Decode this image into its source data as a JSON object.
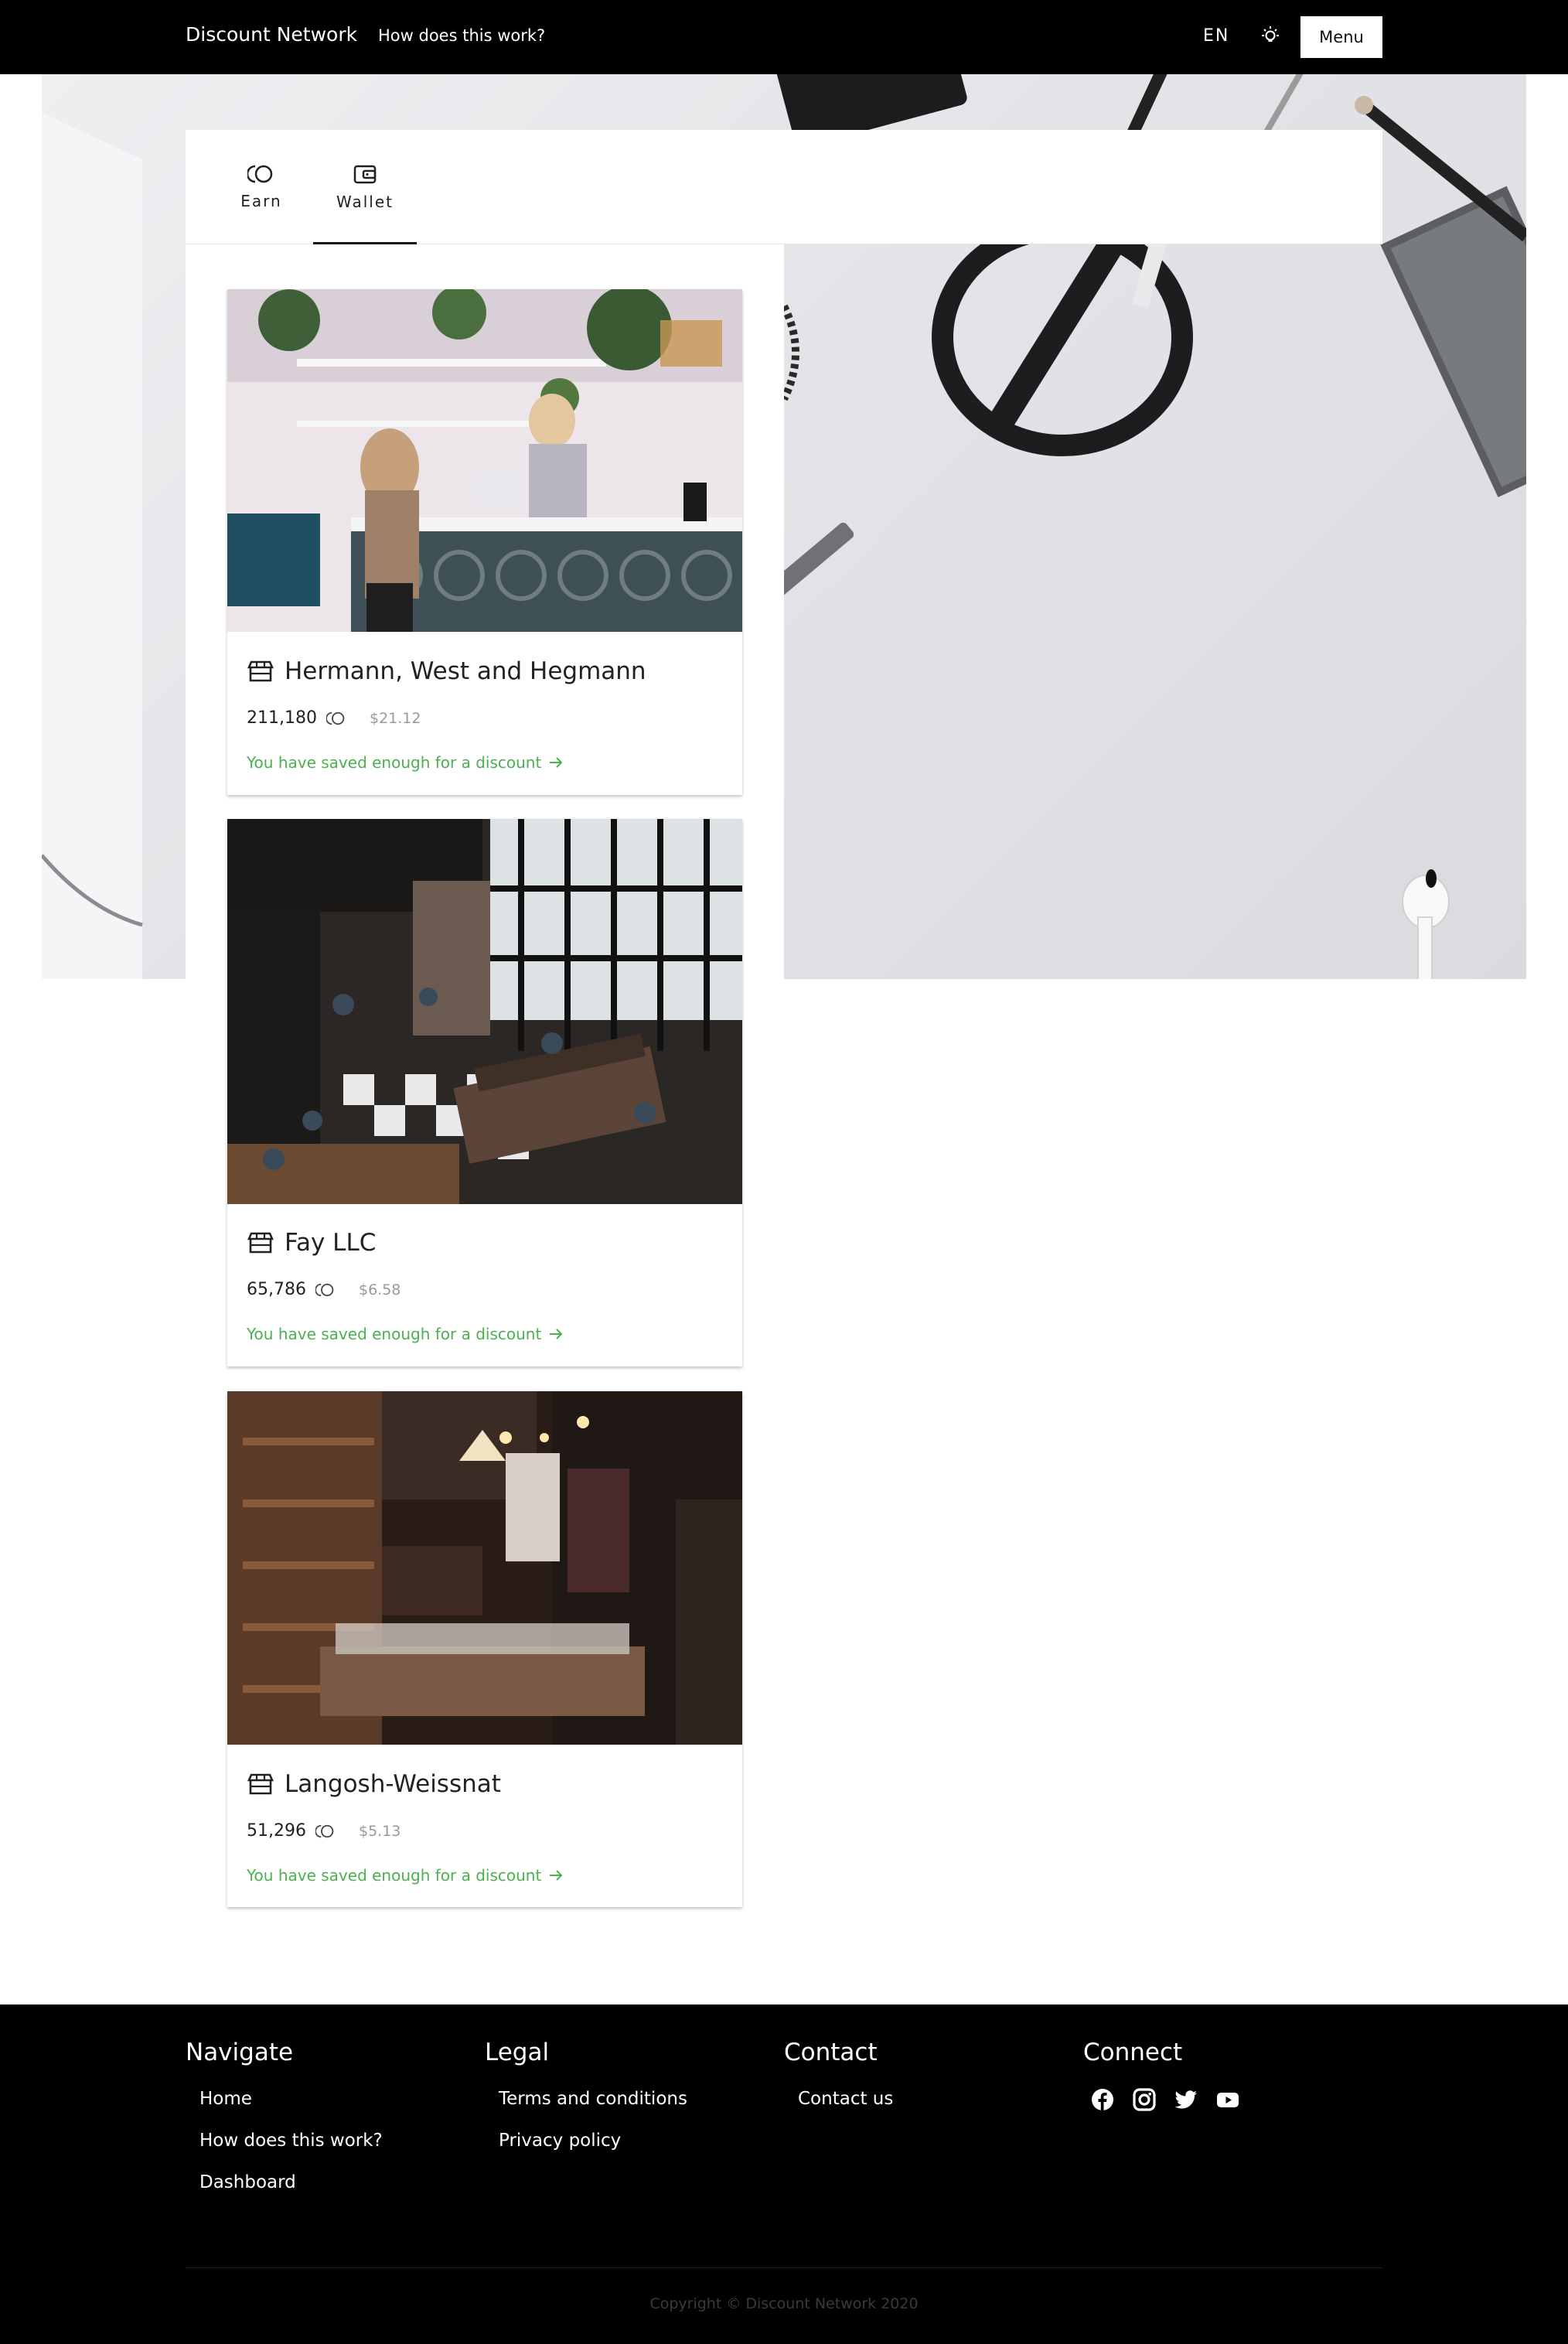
{
  "nav": {
    "brand": "Discount Network",
    "how_link": "How does this work?",
    "language": "EN",
    "menu_label": "Menu"
  },
  "tabs": [
    {
      "label": "Earn",
      "icon": "coins-icon",
      "active": false
    },
    {
      "label": "Wallet",
      "icon": "wallet-icon",
      "active": true
    }
  ],
  "cards": [
    {
      "name": "Hermann, West and Hegmann",
      "points": "211,180",
      "usd": "$21.12",
      "status": "You have saved enough for a discount",
      "photo": "shop-counter-photo"
    },
    {
      "name": "Fay LLC",
      "points": "65,786",
      "usd": "$6.58",
      "status": "You have saved enough for a discount",
      "photo": "cafe-interior-photo"
    },
    {
      "name": "Langosh-Weissnat",
      "points": "51,296",
      "usd": "$5.13",
      "status": "You have saved enough for a discount",
      "photo": "vintage-store-photo"
    }
  ],
  "footer": {
    "navigate": {
      "heading": "Navigate",
      "links": [
        "Home",
        "How does this work?",
        "Dashboard"
      ]
    },
    "legal": {
      "heading": "Legal",
      "links": [
        "Terms and conditions",
        "Privacy policy"
      ]
    },
    "contact": {
      "heading": "Contact",
      "links": [
        "Contact us"
      ]
    },
    "connect": {
      "heading": "Connect",
      "icons": [
        "facebook-icon",
        "instagram-icon",
        "twitter-icon",
        "youtube-icon"
      ]
    },
    "copyright": "Copyright © Discount Network 2020"
  },
  "colors": {
    "accent_green": "#4caf50",
    "nav_bg": "#000000",
    "footer_bg": "#000000"
  }
}
